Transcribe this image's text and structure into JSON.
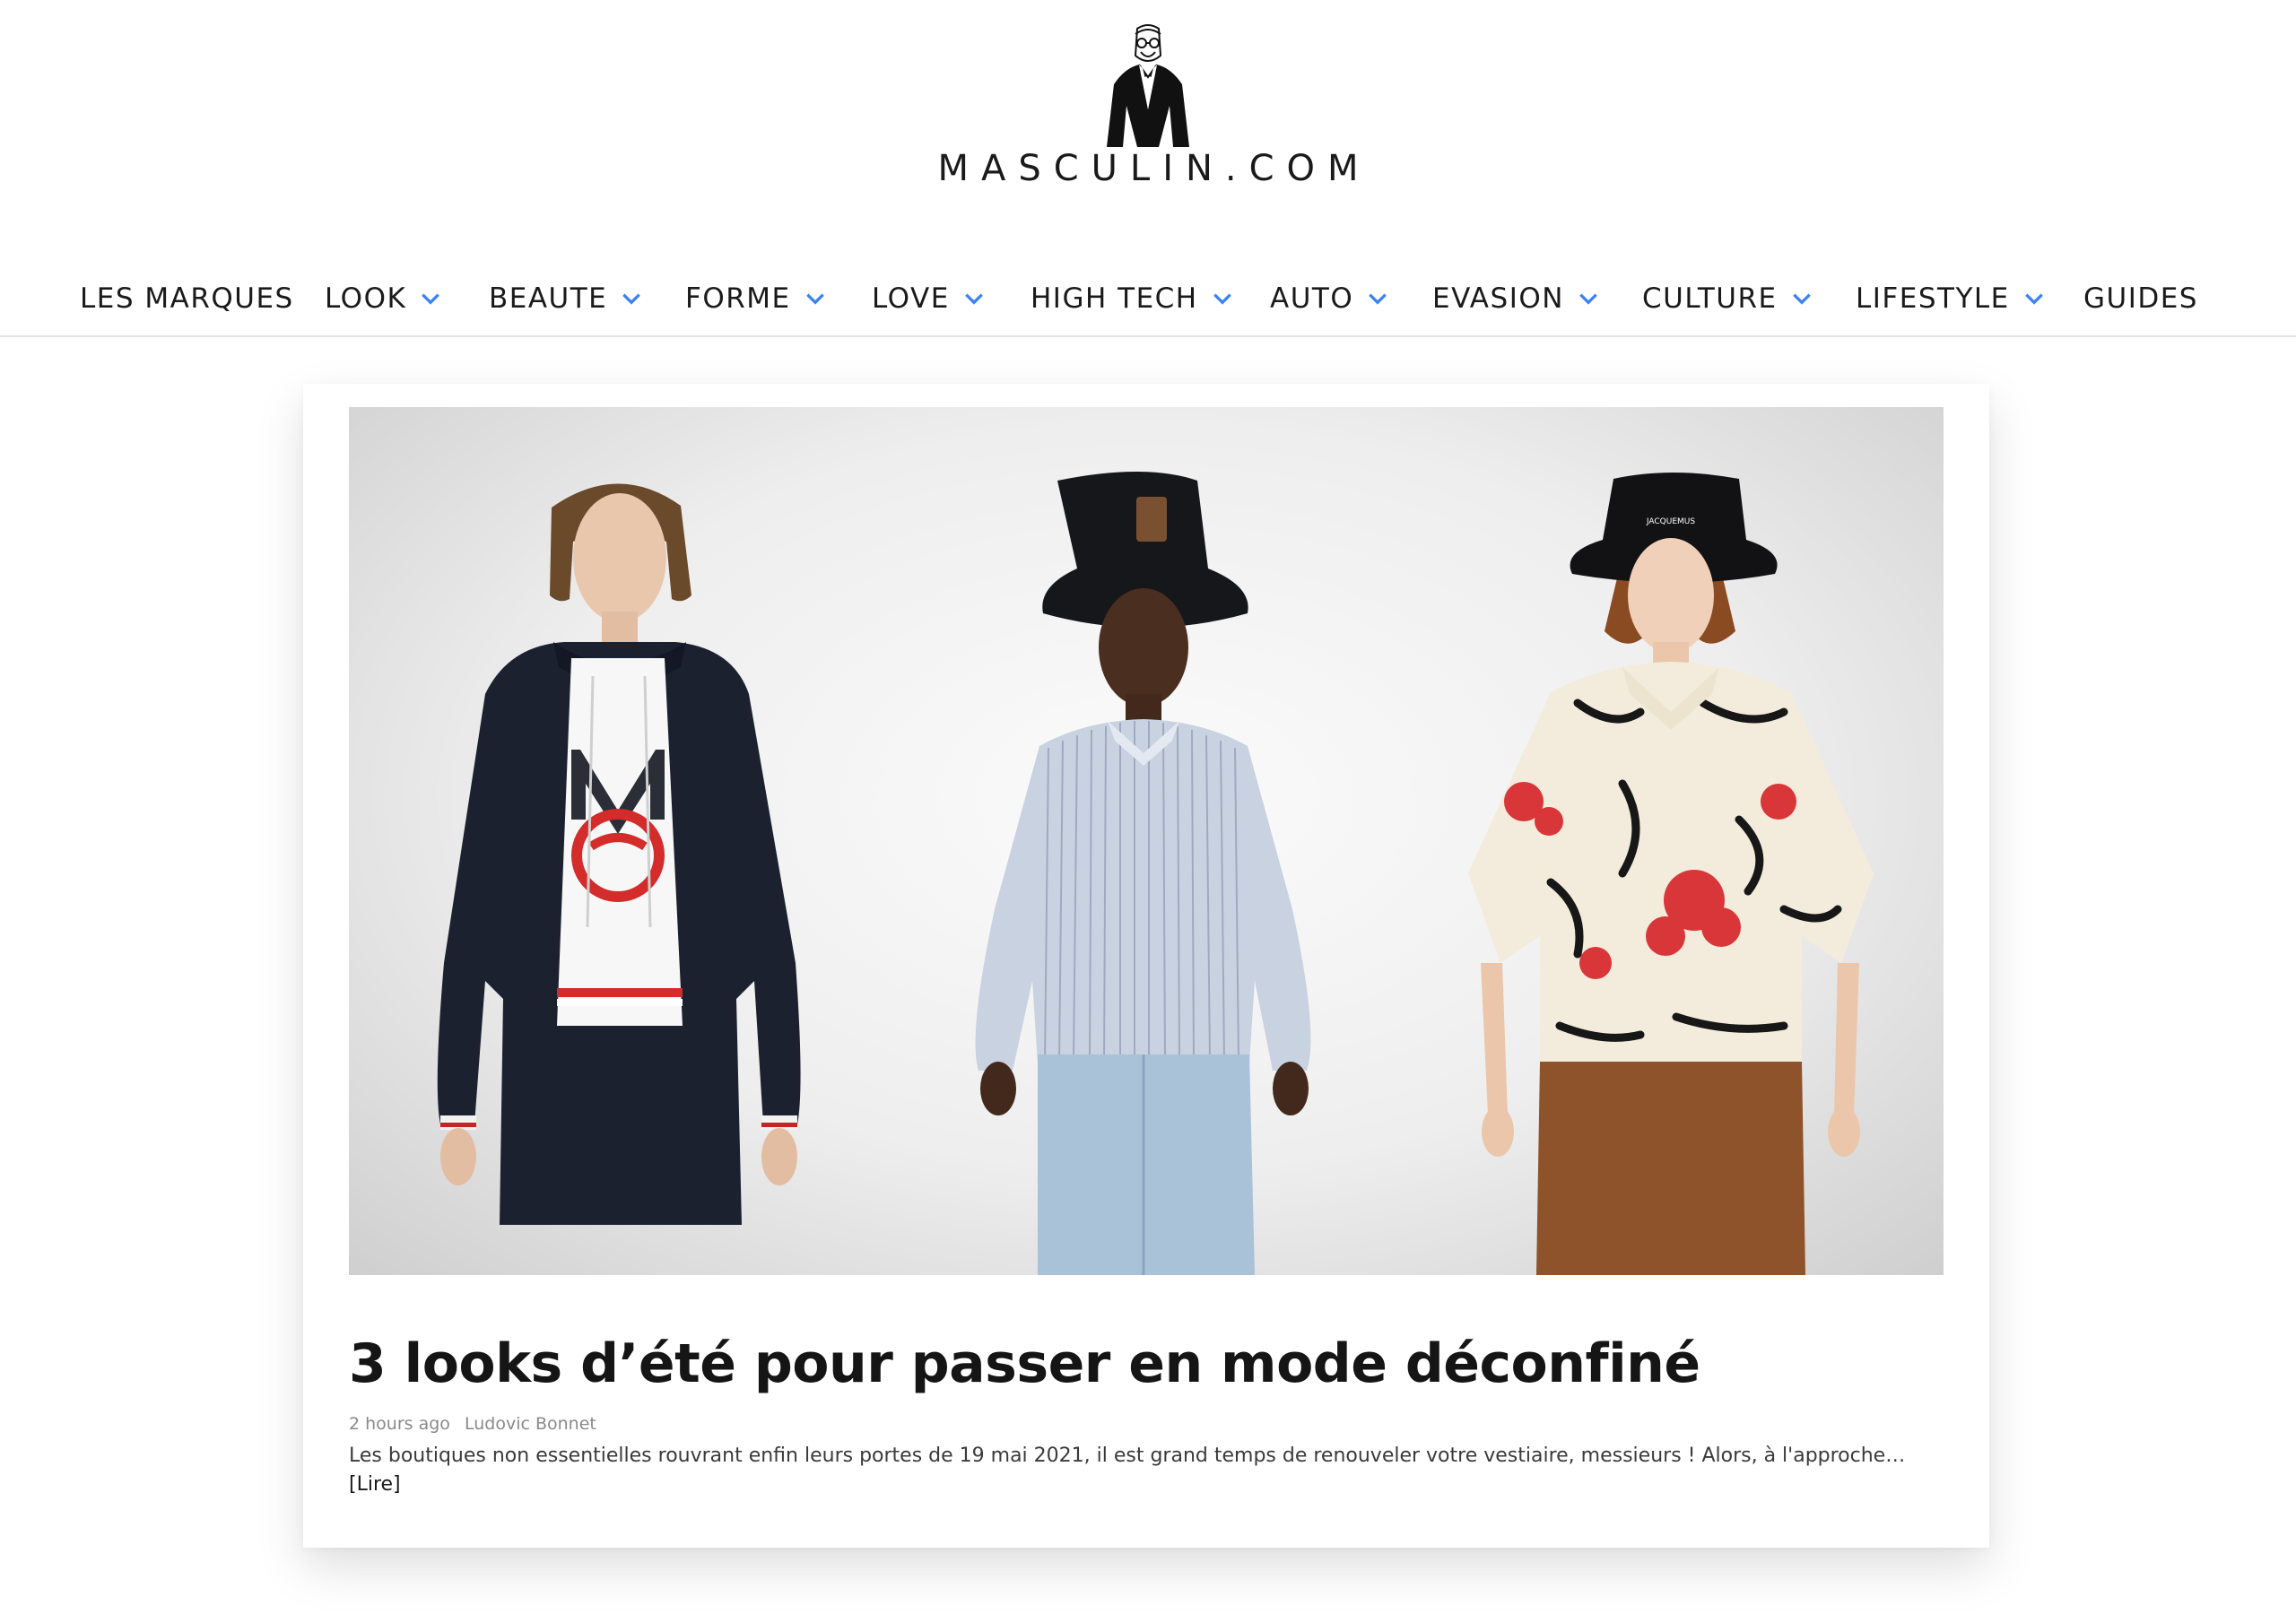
{
  "site": {
    "logo_text": "MASCULIN.COM",
    "logo_icon": "gentleman-logo-icon"
  },
  "nav": {
    "items": [
      {
        "label": "LES MARQUES",
        "has_dropdown": false
      },
      {
        "label": "LOOK",
        "has_dropdown": true
      },
      {
        "label": "BEAUTE",
        "has_dropdown": true
      },
      {
        "label": "FORME",
        "has_dropdown": true
      },
      {
        "label": "LOVE",
        "has_dropdown": true
      },
      {
        "label": "HIGH TECH",
        "has_dropdown": true
      },
      {
        "label": "AUTO",
        "has_dropdown": true
      },
      {
        "label": "EVASION",
        "has_dropdown": true
      },
      {
        "label": "CULTURE",
        "has_dropdown": true
      },
      {
        "label": "LIFESTYLE",
        "has_dropdown": true
      },
      {
        "label": "GUIDES",
        "has_dropdown": false
      }
    ],
    "chevron_icon": "chevron-down-icon",
    "chevron_color": "#3b82f6"
  },
  "article": {
    "title": "3 looks d’été pour passer en mode déconfiné",
    "time_ago": "2 hours ago",
    "author": "Ludovic Bonnet",
    "excerpt": "Les boutiques non essentielles rouvrant enfin leurs portes de 19 mai 2021, il est grand temps de renouveler votre vestiaire, messieurs ! Alors, à l'approche…",
    "read_more": "[Lire]",
    "hero_logo_text": "JACQUEMUS"
  }
}
